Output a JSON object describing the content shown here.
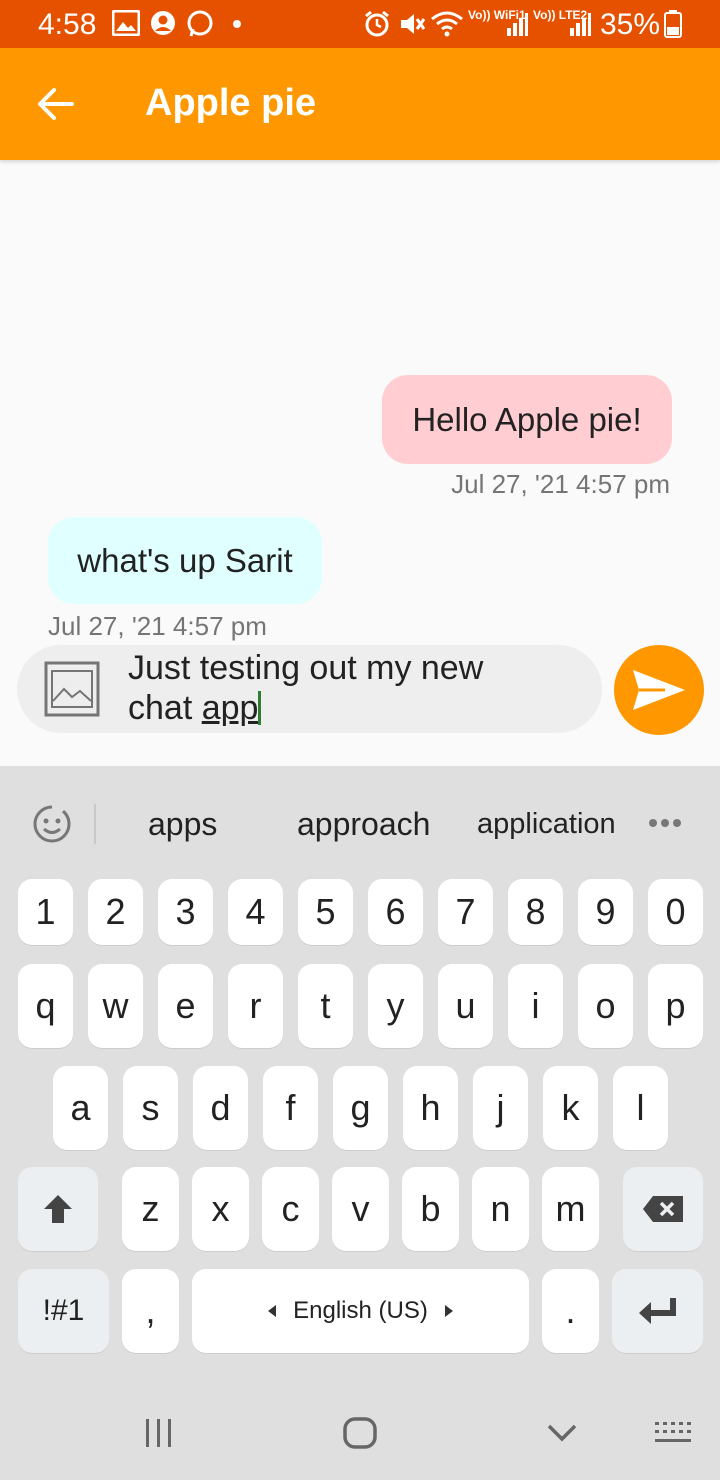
{
  "status_bar": {
    "time": "4:58",
    "battery": "35%",
    "icons": [
      "gallery-icon",
      "account-icon",
      "whatsapp-icon",
      "dot-icon",
      "alarm-icon",
      "mute-icon",
      "wifi-icon",
      "signal-icon",
      "battery-icon"
    ],
    "net_wifi_label": "Vo)) WiFi1",
    "net_lte_label": "Vo)) LTE2"
  },
  "app_bar": {
    "title": "Apple pie",
    "back_icon": "arrow-back-icon",
    "color": "#ff9800"
  },
  "messages": [
    {
      "direction": "outgoing",
      "text": "Hello Apple pie!",
      "time": "Jul 27, '21 4:57 pm",
      "color": "#ffcdd2"
    },
    {
      "direction": "incoming",
      "text": "what's up Sarit",
      "time": "Jul 27, '21 4:57 pm",
      "color": "#e0ffff"
    }
  ],
  "composer": {
    "text_line1": "Just testing out my new",
    "text_line2_prefix": "chat ",
    "text_line2_word": "app",
    "image_icon": "image-icon",
    "send_icon": "send-icon"
  },
  "keyboard": {
    "suggestions": [
      "apps",
      "approach",
      "application"
    ],
    "row_numbers": [
      "1",
      "2",
      "3",
      "4",
      "5",
      "6",
      "7",
      "8",
      "9",
      "0"
    ],
    "row_q": [
      "q",
      "w",
      "e",
      "r",
      "t",
      "y",
      "u",
      "i",
      "o",
      "p"
    ],
    "row_a": [
      "a",
      "s",
      "d",
      "f",
      "g",
      "h",
      "j",
      "k",
      "l"
    ],
    "row_z": [
      "z",
      "x",
      "c",
      "v",
      "b",
      "n",
      "m"
    ],
    "symbols_label": "!#1",
    "comma": ",",
    "period": ".",
    "space_label": "English (US)"
  }
}
